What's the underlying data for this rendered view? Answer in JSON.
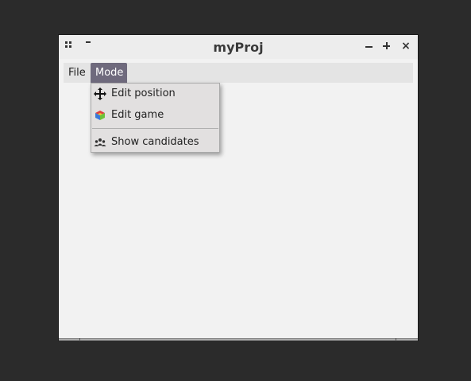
{
  "window": {
    "title": "myProj"
  },
  "menubar": {
    "items": [
      {
        "label": "File"
      },
      {
        "label": "Mode"
      }
    ]
  },
  "mode_menu": {
    "items": [
      {
        "label": "Edit position",
        "icon": "move-arrows-icon"
      },
      {
        "label": "Edit game",
        "icon": "colorful-cube-icon"
      },
      {
        "label": "Show candidates",
        "icon": "people-group-icon"
      }
    ]
  },
  "colors": {
    "desktop": "#2b2b2b",
    "window_bg": "#f2f2f2",
    "active_menu": "#6f6a7d",
    "dropdown_bg": "#e2e0e0"
  }
}
